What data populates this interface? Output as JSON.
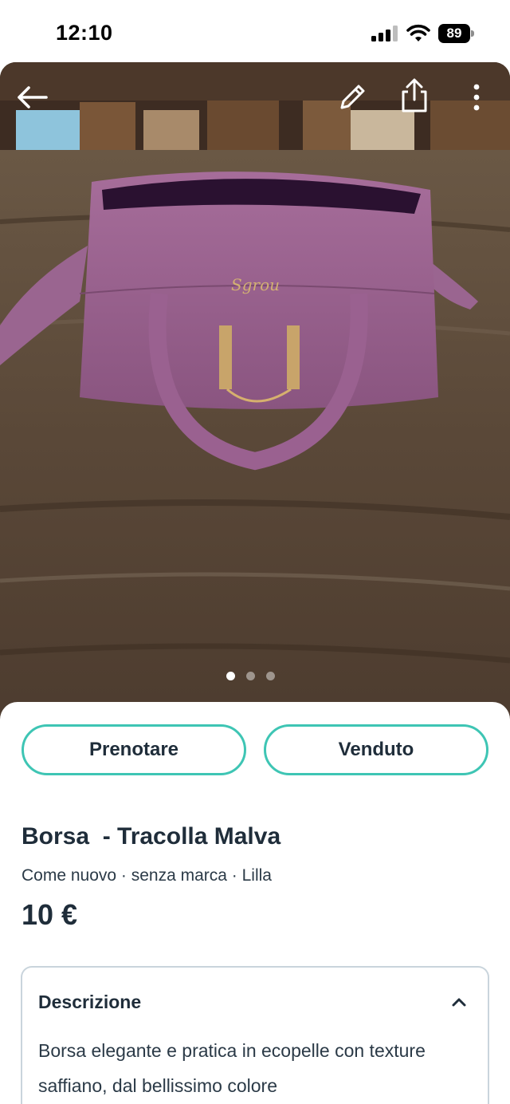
{
  "status_bar": {
    "time": "12:10",
    "battery": "89",
    "icons": [
      "signal-icon",
      "wifi-icon",
      "battery-icon"
    ]
  },
  "header": {
    "icons": [
      "back-arrow-icon",
      "edit-pencil-icon",
      "share-icon",
      "more-vertical-icon"
    ]
  },
  "gallery": {
    "image_count": 3,
    "active_index": 0,
    "subject": "purple handbag on wooden table"
  },
  "actions": {
    "reserve_label": "Prenotare",
    "sold_label": "Venduto"
  },
  "listing": {
    "title": "Borsa  - Tracolla Malva",
    "subtitle": "Come nuovo · senza marca · Lilla",
    "price": "10 €"
  },
  "description": {
    "header": "Descrizione",
    "text": "Borsa elegante e pratica in ecopelle con texture saffiano, dal bellissimo colore"
  },
  "colors": {
    "accent": "#3ec5b4",
    "text": "#1f2d3a",
    "border": "#c9d4dc"
  }
}
